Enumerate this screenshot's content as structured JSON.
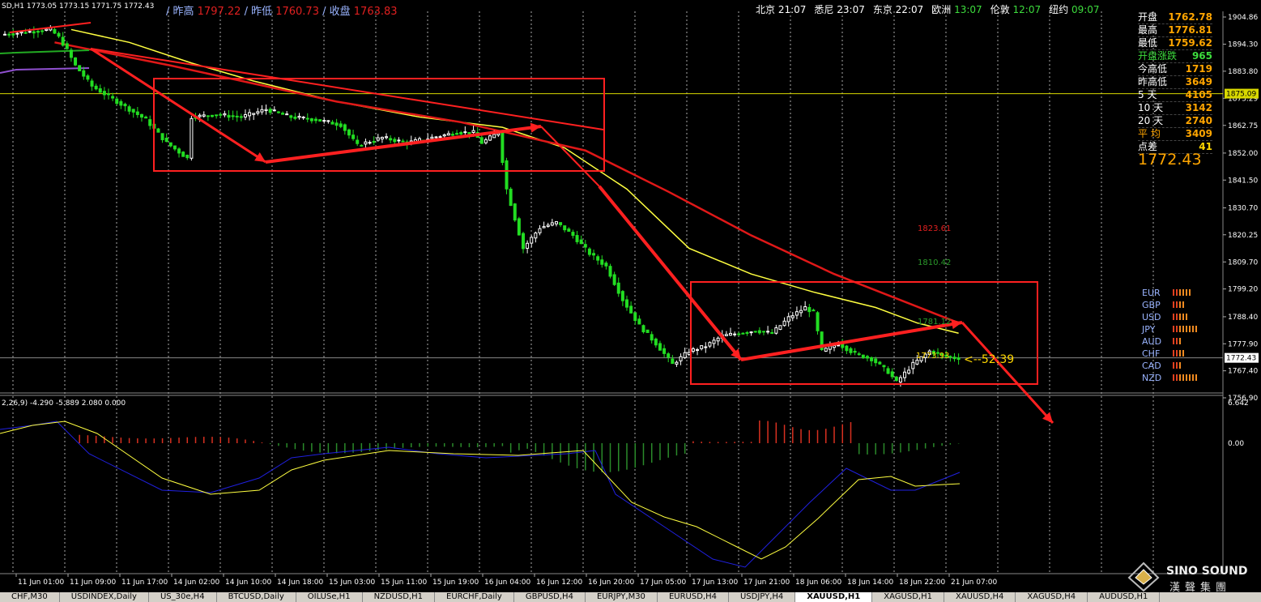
{
  "header": {
    "symbol": "SD,H1",
    "ohlc": "1773.05 1773.15 1771.75 1772.43",
    "prev_high_label": "/ 昨高",
    "prev_high": "1797.22",
    "prev_low_label": "/ 昨低",
    "prev_low": "1760.73",
    "close_label": "/ 收盘",
    "close": "1763.83",
    "clocks": [
      {
        "city": "北京",
        "time": "21:07",
        "color": "#ffffff"
      },
      {
        "city": "悉尼",
        "time": "23:07",
        "color": "#ffffff"
      },
      {
        "city": "东京",
        "time": "22:07",
        "color": "#ffffff"
      },
      {
        "city": "欧洲",
        "time": "13:07",
        "color": "#3ddc3d"
      },
      {
        "city": "伦敦",
        "time": "12:07",
        "color": "#3ddc3d"
      },
      {
        "city": "纽约",
        "time": "09:07",
        "color": "#3ddc3d"
      }
    ]
  },
  "stats_panel": [
    {
      "label": "开盘",
      "value": "1762.78",
      "label_color": "#ffffff",
      "value_color": "#ffa500"
    },
    {
      "label": "最高",
      "value": "1776.81",
      "label_color": "#ffffff",
      "value_color": "#ffa500"
    },
    {
      "label": "最低",
      "value": "1759.62",
      "label_color": "#ffffff",
      "value_color": "#ffa500"
    },
    {
      "label": "开盘涨跌",
      "value": "965",
      "label_color": "#3ddc3d",
      "value_color": "#3ddc3d"
    },
    {
      "label": "今高低",
      "value": "1719",
      "label_color": "#ffffff",
      "value_color": "#ffa500"
    },
    {
      "label": "昨高低",
      "value": "3649",
      "label_color": "#ffffff",
      "value_color": "#ffa500"
    },
    {
      "label": "5 天",
      "value": "4105",
      "label_color": "#ffffff",
      "value_color": "#ffa500"
    },
    {
      "label": "10 天",
      "value": "3142",
      "label_color": "#ffffff",
      "value_color": "#ffa500"
    },
    {
      "label": "20 天",
      "value": "2740",
      "label_color": "#ffffff",
      "value_color": "#ffa500"
    },
    {
      "label": "平 均",
      "value": "3409",
      "label_color": "#ffa500",
      "value_color": "#ffa500"
    },
    {
      "label": "点差",
      "value": "41",
      "label_color": "#ffffff",
      "value_color": "#ffd700"
    }
  ],
  "current_price_big": "1772.43",
  "currency_strength": [
    {
      "name": "EUR",
      "bars": 6
    },
    {
      "name": "GBP",
      "bars": 4
    },
    {
      "name": "USD",
      "bars": 5
    },
    {
      "name": "JPY",
      "bars": 8
    },
    {
      "name": "AUD",
      "bars": 3
    },
    {
      "name": "CHF",
      "bars": 4
    },
    {
      "name": "CAD",
      "bars": 3
    },
    {
      "name": "NZD",
      "bars": 8
    }
  ],
  "annotations": {
    "level_1823": "1823.61",
    "level_1810": "1810.42",
    "level_1781": "1781.12",
    "level_1773": "1773.93",
    "countdown": "<--52:39"
  },
  "horizontal_line_label": "1875.09",
  "current_price_label": "1772.43",
  "macd_header": "2,26,9) -4.290 -5.889 2.080 0.000",
  "tabs": [
    "CHF,M30",
    "USDINDEX,Daily",
    "US_30e,H4",
    "BTCUSD,Daily",
    "OILUSe,H1",
    "NZDUSD,H1",
    "EURCHF,Daily",
    "GBPUSD,H4",
    "EURJPY,M30",
    "EURUSD,H4",
    "USDJPY,H4",
    "XAUUSD,H1",
    "XAGUSD,H1",
    "XAUUSD,H4",
    "XAGUSD,H4",
    "AUDUSD,H1"
  ],
  "active_tab": "XAUUSD,H1",
  "logo": {
    "name": "SINO SOUND",
    "sub": "漢聲集團"
  },
  "chart_data": {
    "type": "candlestick",
    "title": "",
    "xlabel": "",
    "ylabel": "",
    "ylim": [
      1756.9,
      1904.86
    ],
    "y_ticks": [
      1904.86,
      1894.3,
      1883.8,
      1873.29,
      1862.75,
      1852.0,
      1841.5,
      1830.7,
      1820.25,
      1809.7,
      1799.2,
      1788.4,
      1777.9,
      1767.4,
      1756.9
    ],
    "x_ticks": [
      "11 Jun 01:00",
      "11 Jun 09:00",
      "11 Jun 17:00",
      "14 Jun 02:00",
      "14 Jun 10:00",
      "14 Jun 18:00",
      "15 Jun 03:00",
      "15 Jun 11:00",
      "15 Jun 19:00",
      "16 Jun 04:00",
      "16 Jun 12:00",
      "16 Jun 20:00",
      "17 Jun 05:00",
      "17 Jun 13:00",
      "17 Jun 21:00",
      "18 Jun 06:00",
      "18 Jun 14:00",
      "18 Jun 22:00",
      "21 Jun 07:00"
    ],
    "price_path": [
      [
        0,
        1898
      ],
      [
        12,
        1900
      ],
      [
        14,
        1897
      ],
      [
        16,
        1892
      ],
      [
        18,
        1886
      ],
      [
        22,
        1878
      ],
      [
        28,
        1872
      ],
      [
        35,
        1865
      ],
      [
        40,
        1856
      ],
      [
        45,
        1850
      ],
      [
        46,
        1866
      ],
      [
        52,
        1867
      ],
      [
        58,
        1866
      ],
      [
        64,
        1869
      ],
      [
        70,
        1866
      ],
      [
        76,
        1865
      ],
      [
        82,
        1863
      ],
      [
        86,
        1855
      ],
      [
        92,
        1858
      ],
      [
        98,
        1856
      ],
      [
        104,
        1858
      ],
      [
        110,
        1860
      ],
      [
        114,
        1860
      ],
      [
        116,
        1856
      ],
      [
        118,
        1858
      ],
      [
        120,
        1860
      ],
      [
        122,
        1838
      ],
      [
        126,
        1815
      ],
      [
        130,
        1823
      ],
      [
        134,
        1825
      ],
      [
        138,
        1820
      ],
      [
        142,
        1813
      ],
      [
        146,
        1808
      ],
      [
        150,
        1795
      ],
      [
        154,
        1785
      ],
      [
        158,
        1778
      ],
      [
        162,
        1770
      ],
      [
        166,
        1775
      ],
      [
        170,
        1777
      ],
      [
        174,
        1781
      ],
      [
        178,
        1782
      ],
      [
        182,
        1783
      ],
      [
        186,
        1782
      ],
      [
        190,
        1788
      ],
      [
        194,
        1792
      ],
      [
        196,
        1790
      ],
      [
        198,
        1775
      ],
      [
        202,
        1778
      ],
      [
        206,
        1774
      ],
      [
        210,
        1772
      ],
      [
        214,
        1767
      ],
      [
        216,
        1763
      ],
      [
        220,
        1770
      ],
      [
        224,
        1775
      ],
      [
        228,
        1773
      ],
      [
        230,
        1772.43
      ]
    ],
    "trendlines": {
      "downtrend_ma": [
        [
          12,
          1895
        ],
        [
          40,
          1886
        ],
        [
          80,
          1872
        ],
        [
          110,
          1864
        ],
        [
          140,
          1853
        ],
        [
          160,
          1837
        ],
        [
          180,
          1820
        ],
        [
          200,
          1805
        ],
        [
          230,
          1786
        ]
      ],
      "step_line": [
        [
          16,
          1900
        ],
        [
          30,
          1895
        ],
        [
          45,
          1887
        ],
        [
          60,
          1880
        ],
        [
          80,
          1872
        ],
        [
          100,
          1866
        ],
        [
          120,
          1862
        ],
        [
          135,
          1854
        ],
        [
          150,
          1838
        ],
        [
          165,
          1815
        ],
        [
          180,
          1805
        ],
        [
          195,
          1798
        ],
        [
          210,
          1792
        ],
        [
          220,
          1786
        ],
        [
          230,
          1782
        ]
      ]
    },
    "macd": {
      "zero_label": "0.00",
      "top_label": "6.642"
    }
  }
}
